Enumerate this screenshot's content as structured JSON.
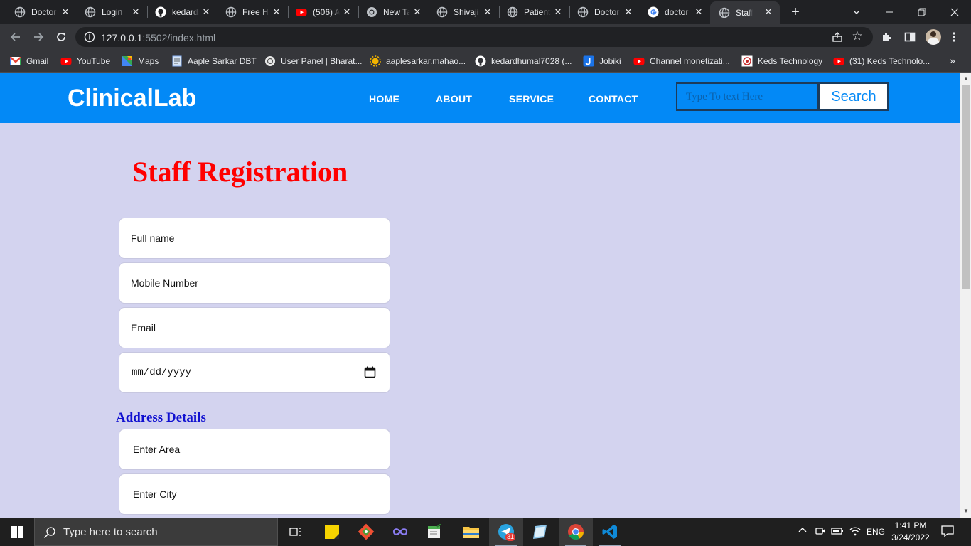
{
  "browser": {
    "tabs": [
      {
        "title": "Doctor",
        "icon": "globe-icon"
      },
      {
        "title": "Login",
        "icon": "globe-icon"
      },
      {
        "title": "kedardhumal",
        "icon": "github-icon"
      },
      {
        "title": "Free H",
        "icon": "globe-icon"
      },
      {
        "title": "(506) A",
        "icon": "youtube-icon"
      },
      {
        "title": "New Tab",
        "icon": "chrome-icon"
      },
      {
        "title": "Shivaji",
        "icon": "globe-icon"
      },
      {
        "title": "Patient",
        "icon": "globe-icon"
      },
      {
        "title": "Doctor",
        "icon": "globe-icon"
      },
      {
        "title": "doctor",
        "icon": "google-icon"
      },
      {
        "title": "Staff R",
        "icon": "globe-icon",
        "active": true
      }
    ],
    "url_host": "127.0.0.1",
    "url_rest": ":5502/index.html",
    "bookmarks": [
      {
        "label": "Gmail",
        "icon": "gmail-icon"
      },
      {
        "label": "YouTube",
        "icon": "youtube-icon"
      },
      {
        "label": "Maps",
        "icon": "maps-icon"
      },
      {
        "label": "Aaple Sarkar DBT",
        "icon": "document-icon"
      },
      {
        "label": "User Panel | Bharat...",
        "icon": "emblem-icon"
      },
      {
        "label": "aaplesarkar.mahao...",
        "icon": "sun-icon"
      },
      {
        "label": "kedardhumal7028 (...",
        "icon": "github-icon"
      },
      {
        "label": "Jobiki",
        "icon": "jobiki-icon"
      },
      {
        "label": "Channel monetizati...",
        "icon": "youtube-icon"
      },
      {
        "label": "Keds Technology",
        "icon": "keds-icon"
      },
      {
        "label": "(31) Keds Technolo...",
        "icon": "youtube-icon"
      }
    ]
  },
  "site": {
    "logo": "ClinicalLab",
    "nav": [
      "HOME",
      "ABOUT",
      "SERVICE",
      "CONTACT"
    ],
    "search_placeholder": "Type To text Here",
    "search_button": "Search"
  },
  "form": {
    "title": "Staff Registration",
    "fullname_placeholder": "Full name",
    "mobile_placeholder": "Mobile Number",
    "email_placeholder": "Email",
    "date_placeholder": "mm/dd/yyyy",
    "address_heading": "Address Details",
    "area_placeholder": "Enter Area",
    "city_placeholder": "Enter City"
  },
  "taskbar": {
    "search_placeholder": "Type here to search",
    "telegram_badge": "31",
    "language": "ENG",
    "time": "1:41 PM",
    "date": "3/24/2022"
  },
  "colors": {
    "nav_bg": "#0389f6",
    "page_bg": "#d3d3ef",
    "heading": "#ff0000",
    "subheading": "#1010d0"
  }
}
